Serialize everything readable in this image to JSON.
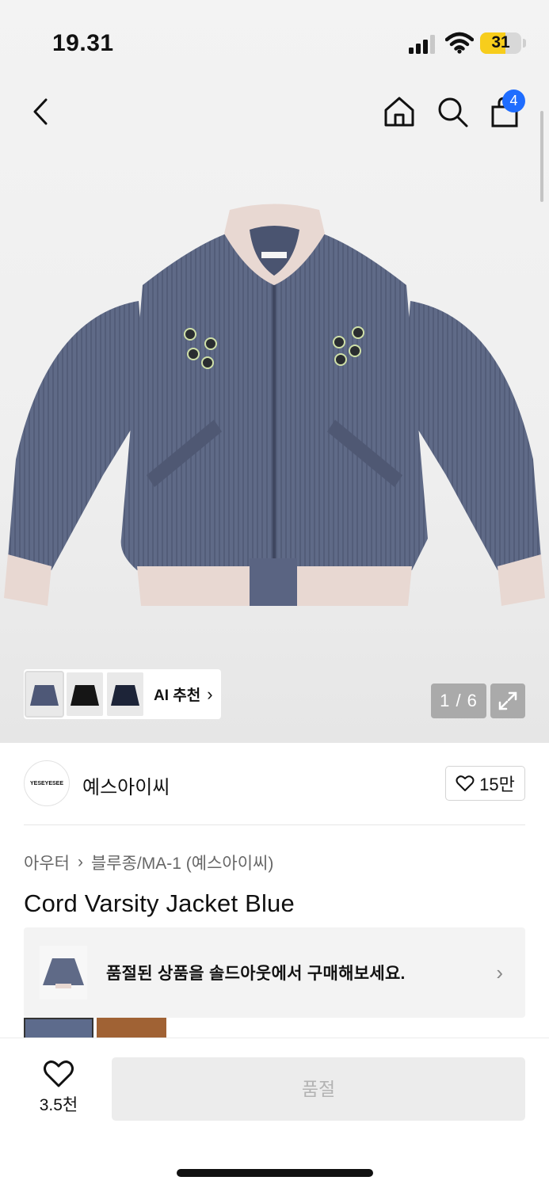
{
  "status_bar": {
    "time": "19.31",
    "battery": "31",
    "battery_color": "#f7cd1c"
  },
  "nav": {
    "back_icon": "chevron-left-icon",
    "home_icon": "home-icon",
    "search_icon": "search-icon",
    "cart_icon": "shopping-bag-icon",
    "cart_badge": "4",
    "badge_color": "#1f6dff"
  },
  "gallery": {
    "image": "corduroy-varsity-jacket-blue",
    "ai_recommend_label": "AI 추천",
    "ai_thumbnails": [
      "navy-jacket",
      "black-jacket",
      "dark-navy-jacket"
    ],
    "counter": "1 / 6",
    "expand_icon": "expand-icon"
  },
  "brand": {
    "logo_text": "YESEYESEE",
    "name": "예스아이씨",
    "like_count": "15만"
  },
  "breadcrumb": [
    "아우터",
    "블루종/MA-1 (예스아이씨)"
  ],
  "product": {
    "title": "Cord Varsity Jacket Blue"
  },
  "soldout_banner": {
    "text": "품절된 상품을 솔드아웃에서 구매해보세요."
  },
  "color_options": [
    "blue",
    "brown"
  ],
  "bottom_bar": {
    "wish_count": "3.5천",
    "buy_button": "품절"
  }
}
